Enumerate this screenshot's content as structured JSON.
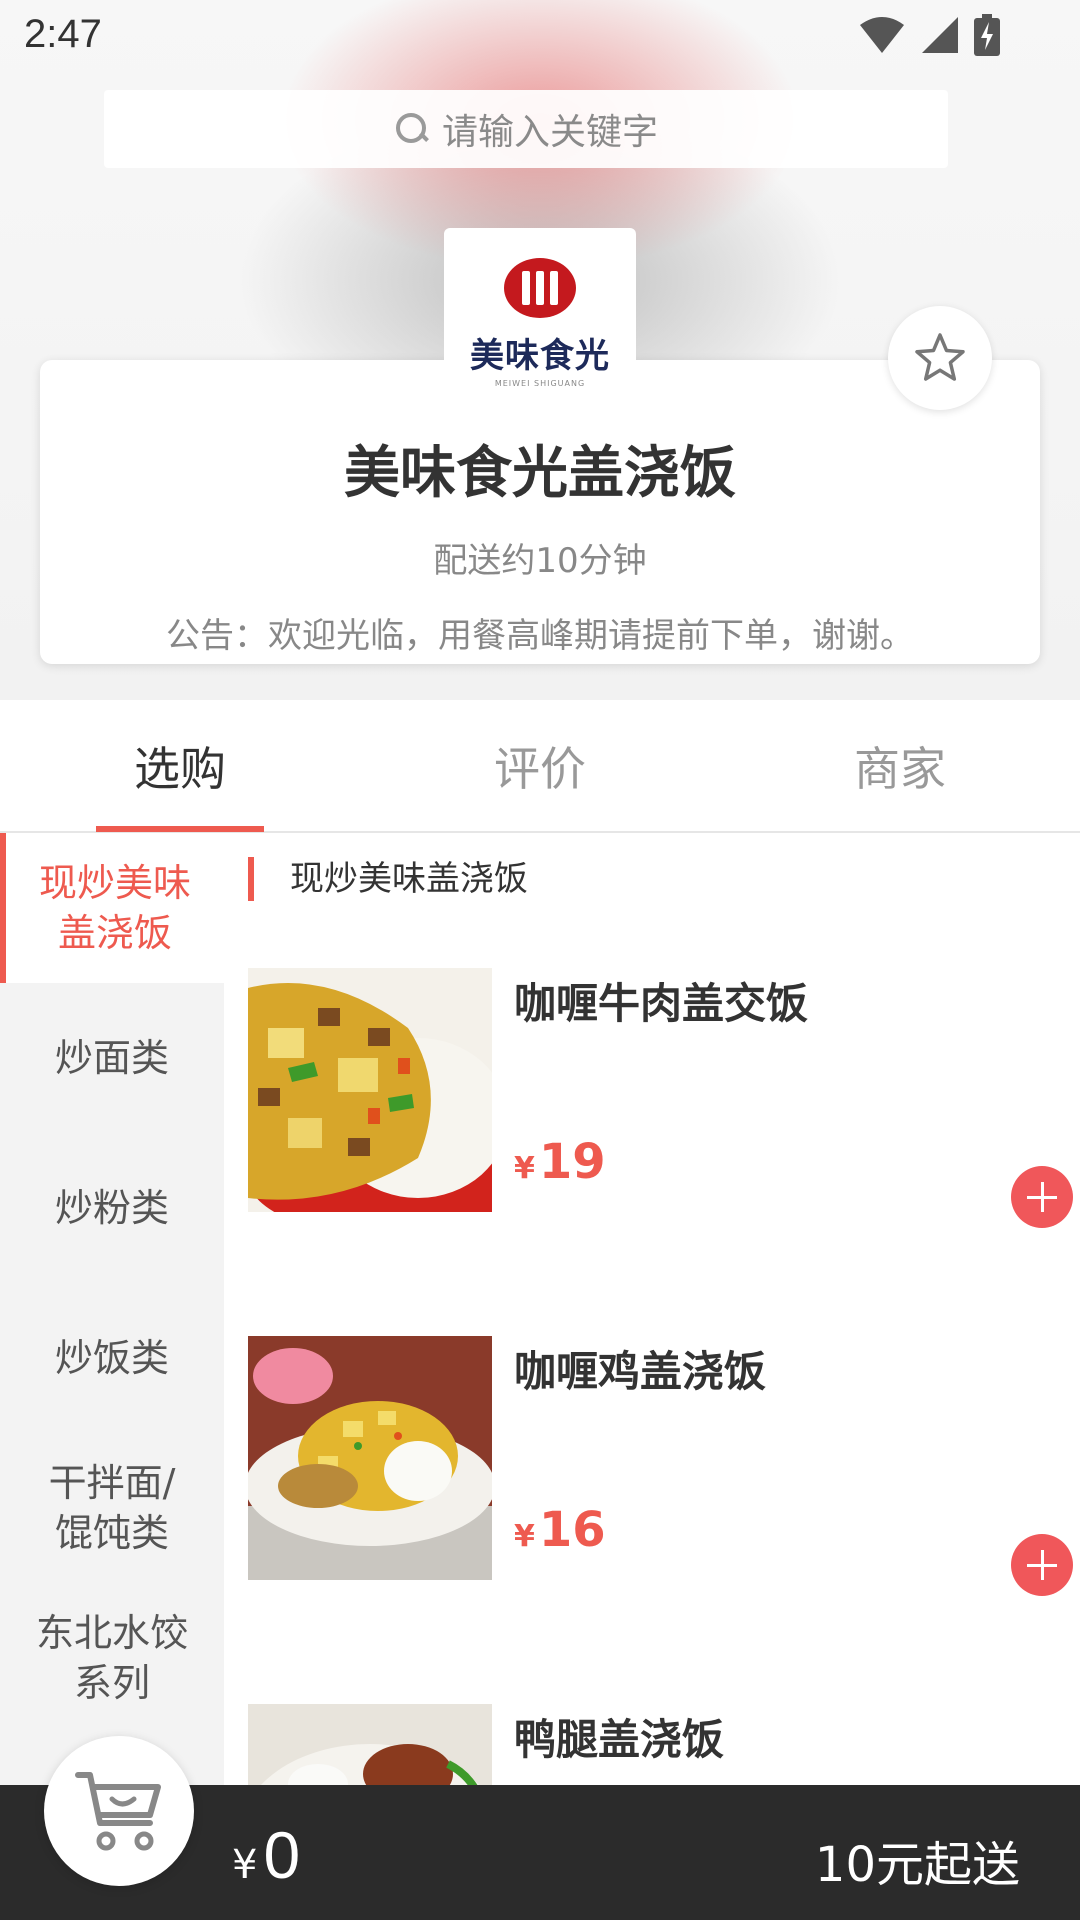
{
  "status_bar": {
    "time": "2:47"
  },
  "search": {
    "placeholder": "请输入关键字"
  },
  "shop": {
    "logo_text": "美味食光",
    "logo_subtext": "MEIWEI SHIGUANG",
    "name": "美味食光盖浇饭",
    "delivery": "配送约10分钟",
    "notice": "公告：欢迎光临，用餐高峰期请提前下单，谢谢。"
  },
  "tabs": [
    {
      "label": "选购",
      "active": true
    },
    {
      "label": "评价",
      "active": false
    },
    {
      "label": "商家",
      "active": false
    }
  ],
  "categories": [
    {
      "label": "现炒美味\n盖浇饭",
      "active": true
    },
    {
      "label": "炒面类"
    },
    {
      "label": "炒粉类"
    },
    {
      "label": "炒饭类"
    },
    {
      "label": "干拌面/\n馄饨类"
    },
    {
      "label": "东北水饺\n系列"
    }
  ],
  "menu": {
    "section_title": "现炒美味盖浇饭",
    "dishes": [
      {
        "name": "咖喱牛肉盖交饭",
        "currency": "¥",
        "price": "19"
      },
      {
        "name": "咖喱鸡盖浇饭",
        "currency": "¥",
        "price": "16"
      },
      {
        "name": "鸭腿盖浇饭"
      }
    ]
  },
  "cart": {
    "currency": "¥",
    "total": "0",
    "min_order": "10元起送"
  },
  "colors": {
    "accent": "#ee5a4f",
    "cart_bar": "#2b2b2b",
    "add_button": "#f0575a"
  },
  "icons": [
    "search-icon",
    "wifi-icon",
    "signal-icon",
    "battery-icon",
    "star-icon",
    "plus-icon",
    "cart-icon"
  ]
}
